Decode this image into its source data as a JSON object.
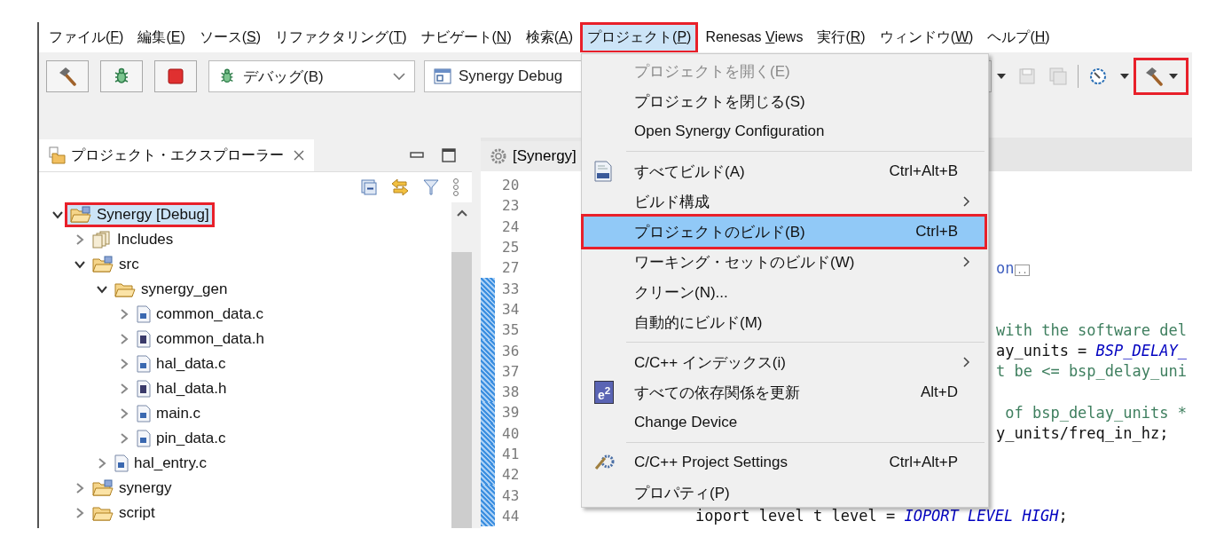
{
  "menubar": [
    {
      "before": "ファイル(",
      "key": "F",
      "after": ")",
      "selected": false,
      "highlighted": false
    },
    {
      "before": "編集(",
      "key": "E",
      "after": ")",
      "selected": false,
      "highlighted": false
    },
    {
      "before": "ソース(",
      "key": "S",
      "after": ")",
      "selected": false,
      "highlighted": false
    },
    {
      "before": "リファクタリング(",
      "key": "T",
      "after": ")",
      "selected": false,
      "highlighted": false
    },
    {
      "before": "ナビゲート(",
      "key": "N",
      "after": ")",
      "selected": false,
      "highlighted": false
    },
    {
      "before": "検索(",
      "key": "A",
      "after": ")",
      "selected": false,
      "highlighted": false
    },
    {
      "before": "プロジェクト(",
      "key": "P",
      "after": ")",
      "selected": true,
      "highlighted": true
    },
    {
      "before": "Renesas ",
      "key": "V",
      "after": "iews",
      "selected": false,
      "highlighted": false
    },
    {
      "before": "実行(",
      "key": "R",
      "after": ")",
      "selected": false,
      "highlighted": false
    },
    {
      "before": "ウィンドウ(",
      "key": "W",
      "after": ")",
      "selected": false,
      "highlighted": false
    },
    {
      "before": "ヘルプ(",
      "key": "H",
      "after": ")",
      "selected": false,
      "highlighted": false
    }
  ],
  "toolbar": {
    "buttons": [
      {
        "kind": "build"
      },
      {
        "kind": "debug"
      },
      {
        "kind": "stop"
      }
    ],
    "launch_mode": "デバッグ(B)",
    "launch_config": "Synergy Debug",
    "right_tools": [
      {
        "kind": "arrow"
      },
      {
        "kind": "save",
        "disabled": true
      },
      {
        "kind": "save-all",
        "disabled": true
      },
      {
        "kind": "separator"
      },
      {
        "kind": "debug-config"
      },
      {
        "kind": "arrow"
      },
      {
        "kind": "build",
        "highlighted": true
      }
    ]
  },
  "explorer": {
    "title": "プロジェクト・エクスプローラー",
    "tree": [
      {
        "label": "Synergy [Debug]",
        "kind": "project",
        "expanded": true,
        "highlighted": true,
        "children": [
          {
            "label": "Includes",
            "kind": "includes",
            "expanded": false,
            "highlighted": false
          },
          {
            "label": "src",
            "kind": "source-folder",
            "expanded": true,
            "highlighted": false,
            "children": [
              {
                "label": "synergy_gen",
                "kind": "folder",
                "expanded": true,
                "highlighted": false,
                "children": [
                  {
                    "label": "common_data.c",
                    "kind": "c-file",
                    "expanded": false,
                    "highlighted": false
                  },
                  {
                    "label": "common_data.h",
                    "kind": "h-file",
                    "expanded": false,
                    "highlighted": false
                  },
                  {
                    "label": "hal_data.c",
                    "kind": "c-file",
                    "expanded": false,
                    "highlighted": false
                  },
                  {
                    "label": "hal_data.h",
                    "kind": "h-file",
                    "expanded": false,
                    "highlighted": false
                  },
                  {
                    "label": "main.c",
                    "kind": "c-file",
                    "expanded": false,
                    "highlighted": false
                  },
                  {
                    "label": "pin_data.c",
                    "kind": "c-file",
                    "expanded": false,
                    "highlighted": false
                  }
                ]
              },
              {
                "label": "hal_entry.c",
                "kind": "c-file",
                "expanded": false,
                "highlighted": false
              }
            ]
          },
          {
            "label": "synergy",
            "kind": "source-folder",
            "expanded": false,
            "highlighted": false
          },
          {
            "label": "script",
            "kind": "folder",
            "expanded": false,
            "highlighted": false
          }
        ]
      }
    ]
  },
  "editor": {
    "tab": "[Synergy]",
    "lines": [
      {
        "number": "20",
        "changed": false,
        "kind": "tail"
      },
      {
        "number": "23",
        "changed": false,
        "kind": "tail"
      },
      {
        "number": "24",
        "changed": false,
        "kind": "tail"
      },
      {
        "number": "25",
        "changed": false,
        "kind": "tail"
      },
      {
        "number": "27",
        "changed": false,
        "kind": "tail",
        "segments": [
          {
            "kind": "doc",
            "text": "on"
          },
          {
            "kind": "fold",
            "text": ".."
          }
        ]
      },
      {
        "number": "33",
        "changed": true,
        "kind": "tail"
      },
      {
        "number": "34",
        "changed": true,
        "kind": "tail"
      },
      {
        "number": "35",
        "changed": true,
        "kind": "tail",
        "segments": [
          {
            "kind": "comment",
            "text": "with the software del"
          }
        ]
      },
      {
        "number": "36",
        "changed": true,
        "kind": "tail",
        "segments": [
          {
            "kind": "code",
            "text": "ay_units = "
          },
          {
            "kind": "constant",
            "text": "BSP_DELAY_"
          }
        ]
      },
      {
        "number": "37",
        "changed": true,
        "kind": "tail",
        "segments": [
          {
            "kind": "comment",
            "text": "t be <= bsp_delay_uni"
          }
        ]
      },
      {
        "number": "38",
        "changed": true,
        "kind": "tail"
      },
      {
        "number": "39",
        "changed": true,
        "kind": "tail",
        "segments": [
          {
            "kind": "comment",
            "text": " of bsp_delay_units *"
          }
        ]
      },
      {
        "number": "40",
        "changed": true,
        "kind": "tail",
        "segments": [
          {
            "kind": "code",
            "text": "y_units/freq_in_hz;"
          }
        ]
      },
      {
        "number": "41",
        "changed": true,
        "kind": "tail"
      },
      {
        "number": "42",
        "changed": true,
        "kind": "tail"
      },
      {
        "number": "43",
        "changed": true,
        "kind": "tail"
      },
      {
        "number": "44",
        "changed": true,
        "kind": "full",
        "segments": [
          {
            "kind": "code",
            "text": "ioport level t level = "
          },
          {
            "kind": "constant",
            "text": "IOPORT LEVEL HIGH"
          },
          {
            "kind": "code",
            "text": ";"
          }
        ]
      }
    ]
  },
  "menu": {
    "items": [
      {
        "kind": "plain",
        "label": "プロジェクトを開く(E)",
        "disabled": true,
        "selected": false,
        "highlighted": false,
        "submenu": false
      },
      {
        "kind": "plain",
        "label": "プロジェクトを閉じる(S)",
        "disabled": false,
        "selected": false,
        "highlighted": false,
        "submenu": false
      },
      {
        "kind": "plain",
        "label": "Open Synergy Configuration",
        "disabled": false,
        "selected": false,
        "highlighted": false,
        "submenu": false
      },
      {
        "kind": "separator"
      },
      {
        "kind": "binary",
        "label": "すべてビルド(A)",
        "shortcut": "Ctrl+Alt+B",
        "disabled": false,
        "selected": false,
        "highlighted": false,
        "submenu": false
      },
      {
        "kind": "plain",
        "label": "ビルド構成",
        "disabled": false,
        "selected": false,
        "highlighted": false,
        "submenu": true
      },
      {
        "kind": "plain",
        "label": "プロジェクトのビルド(B)",
        "shortcut": "Ctrl+B",
        "disabled": false,
        "selected": true,
        "highlighted": true,
        "submenu": false
      },
      {
        "kind": "plain",
        "label": "ワーキング・セットのビルド(W)",
        "disabled": false,
        "selected": false,
        "highlighted": false,
        "submenu": true
      },
      {
        "kind": "plain",
        "label": "クリーン(N)...",
        "disabled": false,
        "selected": false,
        "highlighted": false,
        "submenu": false
      },
      {
        "kind": "plain",
        "label": "自動的にビルド(M)",
        "disabled": false,
        "selected": false,
        "highlighted": false,
        "submenu": false
      },
      {
        "kind": "separator"
      },
      {
        "kind": "plain",
        "label": "C/C++ インデックス(i)",
        "disabled": false,
        "selected": false,
        "highlighted": false,
        "submenu": true
      },
      {
        "kind": "badge",
        "badge": "e$^{2}$",
        "label": "すべての依存関係を更新",
        "shortcut": "Alt+D",
        "disabled": false,
        "selected": false,
        "highlighted": false,
        "submenu": false
      },
      {
        "kind": "plain",
        "label": "Change Device",
        "disabled": false,
        "selected": false,
        "highlighted": false,
        "submenu": false
      },
      {
        "kind": "separator"
      },
      {
        "kind": "tools",
        "label": "C/C++ Project Settings",
        "shortcut": "Ctrl+Alt+P",
        "disabled": false,
        "selected": false,
        "highlighted": false,
        "submenu": false
      },
      {
        "kind": "plain",
        "label": "プロパティ(P)",
        "disabled": false,
        "selected": false,
        "highlighted": false,
        "submenu": false
      }
    ]
  }
}
